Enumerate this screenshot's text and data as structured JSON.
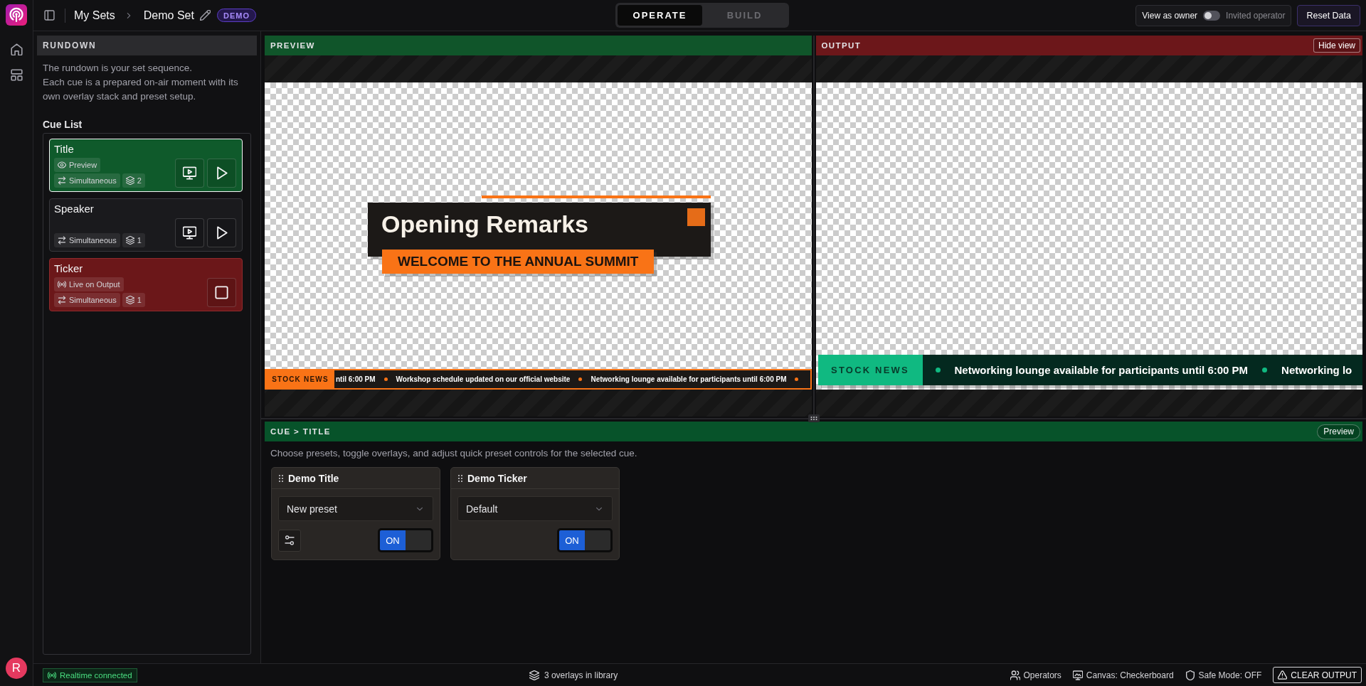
{
  "rail": {
    "avatar": "R"
  },
  "header": {
    "breadcrumb": [
      "My Sets",
      "Demo Set"
    ],
    "badge": "DEMO",
    "mode_tabs": [
      {
        "label": "OPERATE",
        "selected": true
      },
      {
        "label": "BUILD",
        "selected": false
      }
    ],
    "view_toggle": {
      "left_label": "View as owner",
      "right_label": "Invited operator",
      "on": false
    },
    "reset_button": "Reset Data"
  },
  "rundown": {
    "title": "RUNDOWN",
    "description": "The rundown is your set sequence.\nEach cue is a prepared on-air moment with its own overlay stack and preset setup.",
    "list_title": "Cue List",
    "cues": [
      {
        "name": "Title",
        "kind": "preview",
        "selected": true,
        "status": "Preview",
        "mode": "Simultaneous",
        "layers": "2"
      },
      {
        "name": "Speaker",
        "kind": "idle",
        "selected": false,
        "mode": "Simultaneous",
        "layers": "1"
      },
      {
        "name": "Ticker",
        "kind": "live",
        "selected": false,
        "status": "Live on Output",
        "mode": "Simultaneous",
        "layers": "1"
      }
    ]
  },
  "monitors": [
    {
      "kind": "preview",
      "title": "PREVIEW",
      "overlays": [
        {
          "kind": "title_card",
          "title": "Opening Remarks",
          "subtitle": "WELCOME TO THE ANNUAL SUMMIT"
        },
        {
          "kind": "ticker_bar",
          "label": "STOCK NEWS",
          "items": [
            {
              "kind": "text",
              "text": "ntil 6:00 PM"
            },
            {
              "kind": "dot"
            },
            {
              "kind": "text",
              "text": "Workshop schedule updated on our official website"
            },
            {
              "kind": "dot"
            },
            {
              "kind": "text",
              "text": "Networking lounge available for participants until 6:00 PM"
            },
            {
              "kind": "dot"
            }
          ]
        }
      ]
    },
    {
      "kind": "output",
      "title": "OUTPUT",
      "hide_button": "Hide view",
      "overlays": [
        {
          "kind": "ticker_banner",
          "label": "STOCK NEWS",
          "items": [
            {
              "kind": "dot"
            },
            {
              "kind": "text",
              "text": "Networking lounge available for participants until 6:00 PM"
            },
            {
              "kind": "dot"
            },
            {
              "kind": "text",
              "text": "Networking lo"
            }
          ]
        }
      ]
    }
  ],
  "cue_panel": {
    "title": "CUE > TITLE",
    "badge": "Preview",
    "description": "Choose presets, toggle overlays, and adjust quick preset controls for the selected cue.",
    "overlays": [
      {
        "name": "Demo Title",
        "preset": "New preset",
        "settings_button": true,
        "on": true,
        "toggle_label": "ON"
      },
      {
        "name": "Demo Ticker",
        "preset": "Default",
        "settings_button": false,
        "on": true,
        "toggle_label": "ON"
      }
    ]
  },
  "status_bar": {
    "connection": "Realtime connected",
    "library": "3 overlays in library",
    "items": [
      {
        "kind": "users",
        "label": "Operators"
      },
      {
        "kind": "canvas",
        "label": "Canvas: Checkerboard"
      },
      {
        "kind": "shield",
        "label": "Safe Mode: OFF"
      }
    ],
    "clear_button": "CLEAR OUTPUT"
  }
}
